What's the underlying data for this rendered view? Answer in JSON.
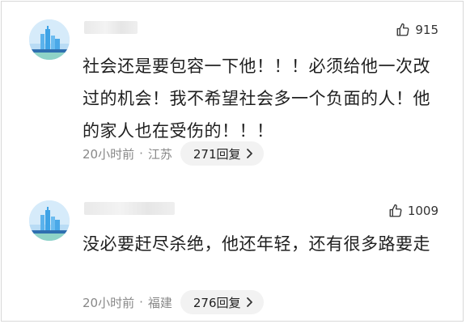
{
  "comments": [
    {
      "likes": "915",
      "text": "社会还是要包容一下他！！！必须给他一次改过的机会！我不希望社会多一个负面的人！他的家人也在受伤的！！！",
      "time": "20小时前",
      "location": "江苏",
      "replies": "271回复"
    },
    {
      "likes": "1009",
      "text": "没必要赶尽杀绝，他还年轻，还有很多路要走",
      "time": "20小时前",
      "location": "福建",
      "replies": "276回复"
    }
  ],
  "icons": {
    "like": "thumbs-up-outline-icon",
    "reply_arrow": "chevron-right-icon"
  },
  "colors": {
    "meta_text": "#888888",
    "reply_pill_bg": "#f2f2f2",
    "avatar_sky": "#cfe6f7"
  }
}
